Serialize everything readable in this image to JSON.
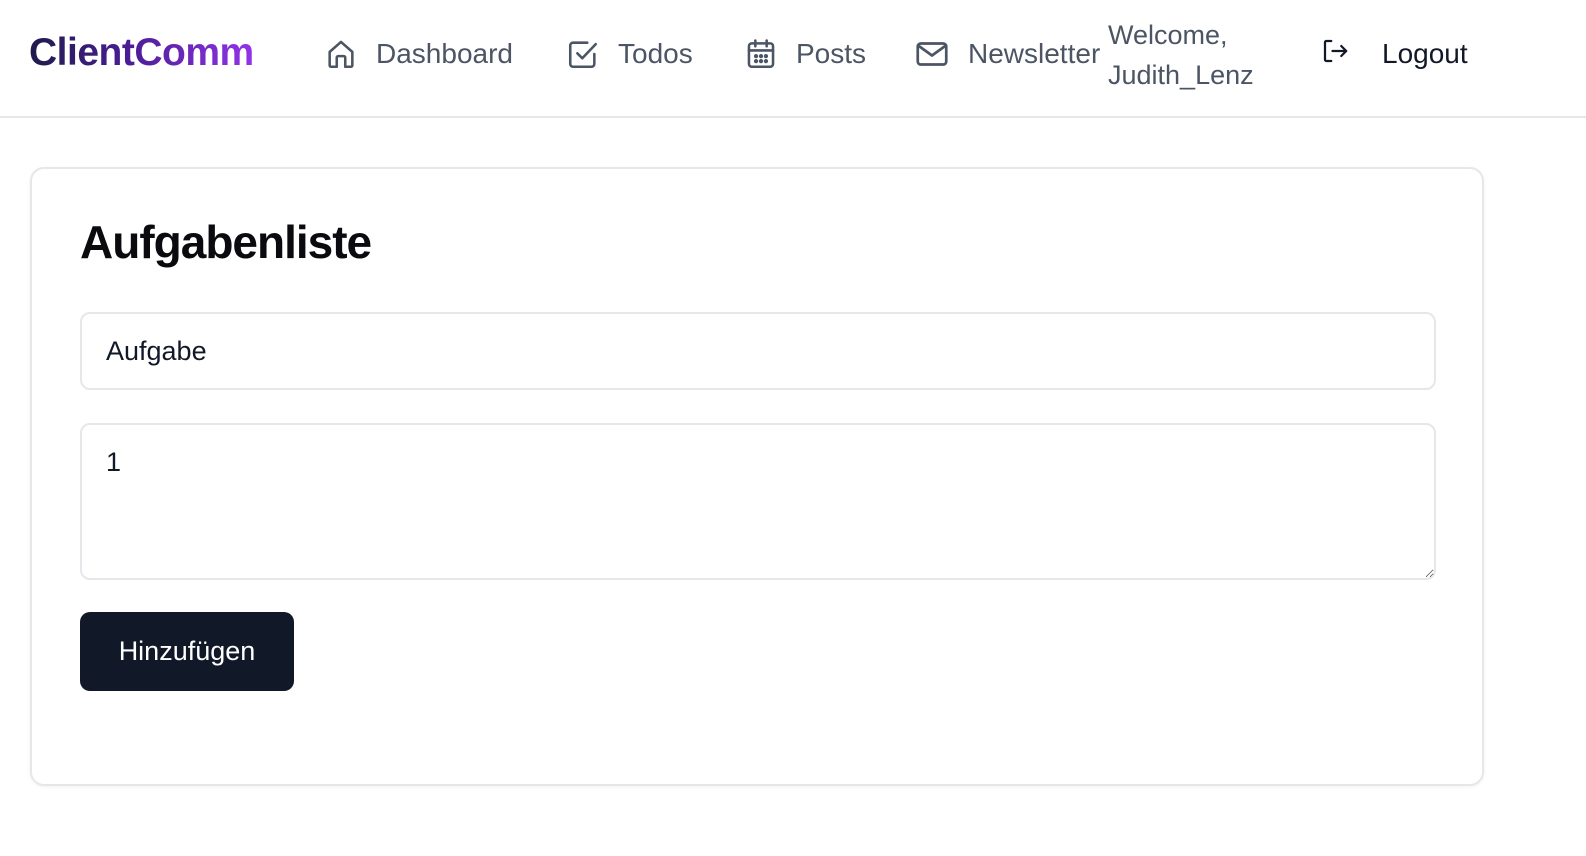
{
  "brand": {
    "name": "ClientComm"
  },
  "nav": {
    "dashboard": {
      "label": "Dashboard",
      "icon": "home-icon"
    },
    "todos": {
      "label": "Todos",
      "icon": "checkbox-icon"
    },
    "posts": {
      "label": "Posts",
      "icon": "calendar-icon"
    },
    "newsletter": {
      "label": "Newsletter",
      "icon": "mail-icon"
    }
  },
  "user": {
    "welcome_line1": "Welcome,",
    "welcome_line2": "Judith_Lenz"
  },
  "logout": {
    "label": "Logout",
    "icon": "logout-icon"
  },
  "todo_form": {
    "heading": "Aufgabenliste",
    "title_value": "Aufgabe",
    "description_value": "1",
    "submit_label": "Hinzufügen"
  },
  "colors": {
    "brand_gradient_start": "#1e1b4b",
    "brand_gradient_end": "#9333ea",
    "button_bg": "#111827",
    "nav_text": "#4b5563",
    "border": "#e5e7eb"
  }
}
